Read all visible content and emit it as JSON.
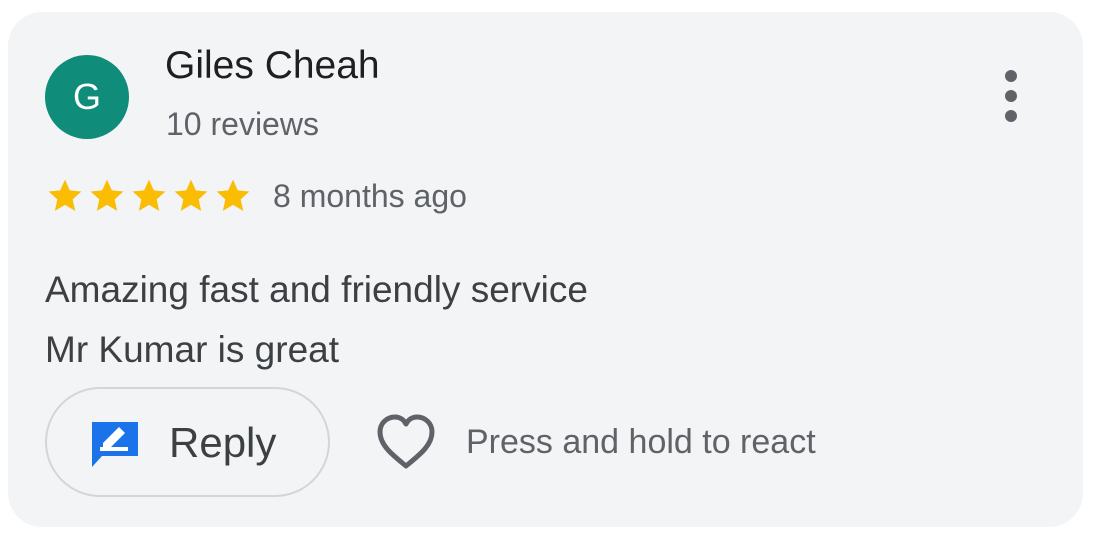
{
  "review": {
    "avatar_initial": "G",
    "avatar_color": "#0f8c7a",
    "reviewer_name": "Giles Cheah",
    "review_count": "10 reviews",
    "rating": 5,
    "rating_max": 5,
    "star_color": "#fbbc04",
    "date": "8 months ago",
    "text_lines": [
      "Amazing fast and friendly service",
      "Mr Kumar is great"
    ],
    "more_icon": "more-vertical-icon"
  },
  "actions": {
    "reply_label": "Reply",
    "reply_icon": "reply-feedback-icon",
    "reply_icon_color": "#1a73e8",
    "react_icon": "heart-outline-icon",
    "react_hint": "Press and hold to react"
  }
}
